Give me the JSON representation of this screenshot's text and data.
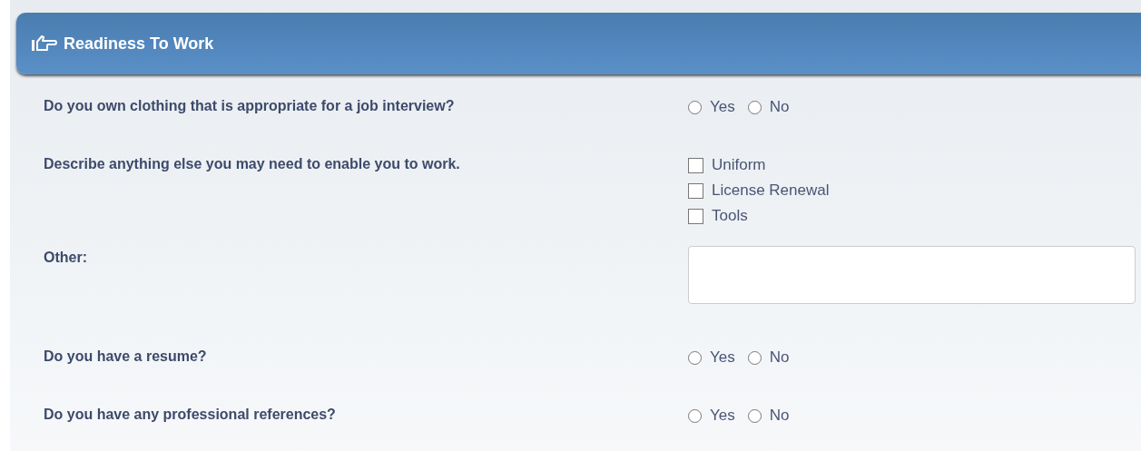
{
  "section": {
    "title": "Readiness To Work"
  },
  "questions": [
    {
      "kind": "radio",
      "label": "Do you own clothing that is appropriate for a job interview?",
      "options": [
        {
          "label": "Yes",
          "selected": false
        },
        {
          "label": "No",
          "selected": false
        }
      ]
    },
    {
      "kind": "checkbox",
      "label": "Describe anything else you may need to enable you to work.",
      "options": [
        {
          "label": "Uniform",
          "checked": false
        },
        {
          "label": "License Renewal",
          "checked": false
        },
        {
          "label": "Tools",
          "checked": false
        }
      ]
    },
    {
      "kind": "text",
      "label": "Other:"
    },
    {
      "kind": "radio",
      "label": "Do you have a resume?",
      "options": [
        {
          "label": "Yes",
          "selected": false
        },
        {
          "label": "No",
          "selected": false
        }
      ]
    },
    {
      "kind": "radio",
      "label": "Do you have any professional references?",
      "options": [
        {
          "label": "Yes",
          "selected": false
        },
        {
          "label": "No",
          "selected": false
        }
      ]
    }
  ]
}
